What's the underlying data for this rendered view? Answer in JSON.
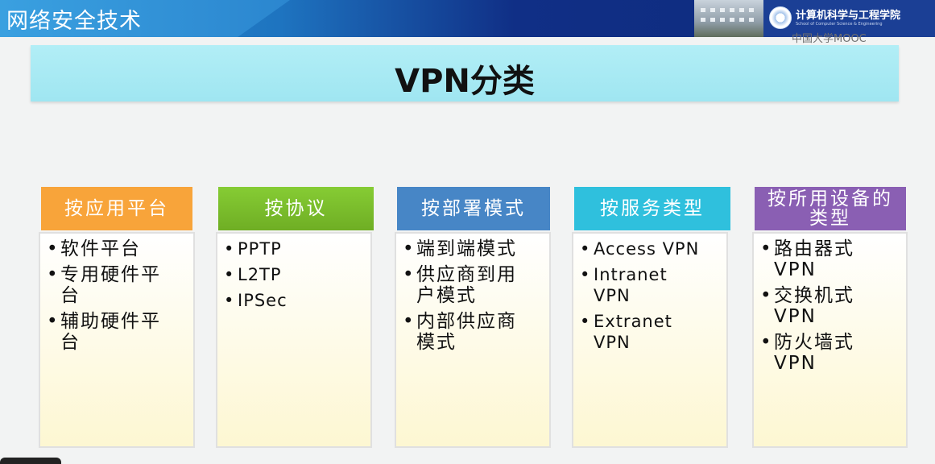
{
  "header": {
    "course_title": "网络安全技术",
    "school_name": "计算机科学与工程学院",
    "school_subtitle": "School of Computer Science & Engineering",
    "watermark": "中国大学MOOC"
  },
  "slide": {
    "title": "VPN分类",
    "columns": [
      {
        "heading": "按应用平台",
        "color": "#f8a43a",
        "items": [
          "软件平台",
          "专用硬件平台",
          "辅助硬件平台"
        ]
      },
      {
        "heading": "按协议",
        "color": "#7cbd2c",
        "items": [
          "PPTP",
          "L2TP",
          "IPSec"
        ]
      },
      {
        "heading": "按部署模式",
        "color": "#4786c6",
        "items": [
          "端到端模式",
          "供应商到用户模式",
          "内部供应商模式"
        ]
      },
      {
        "heading": "按服务类型",
        "color": "#2fc0dd",
        "items": [
          "Access VPN",
          "Intranet VPN",
          "Extranet VPN"
        ]
      },
      {
        "heading": "按所用设备的类型",
        "color": "#8a5fb3",
        "items": [
          "路由器式VPN",
          "交换机式VPN",
          "防火墙式VPN"
        ]
      }
    ]
  }
}
